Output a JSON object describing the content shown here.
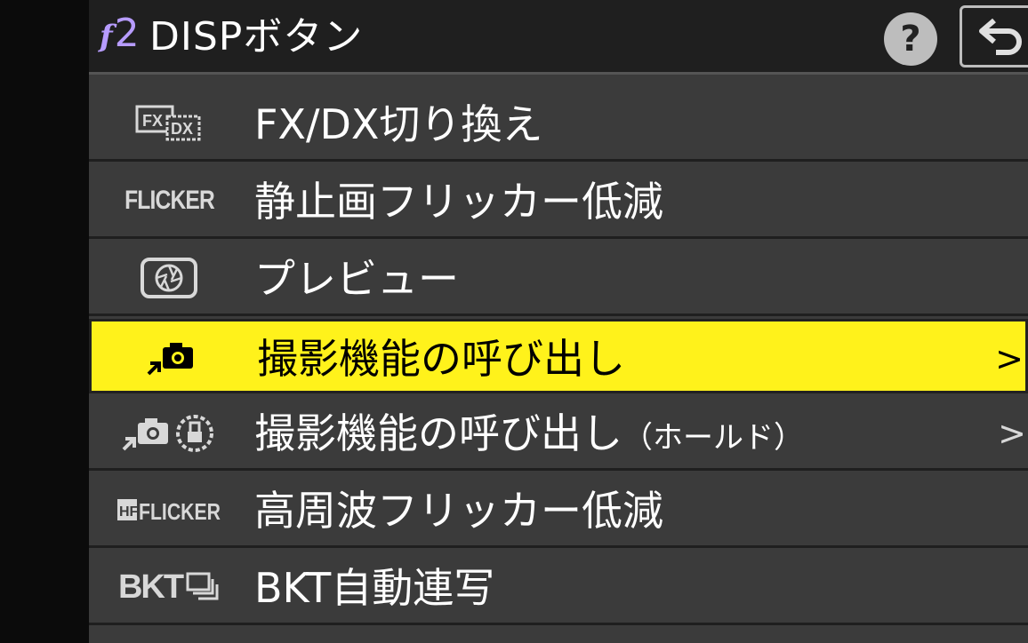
{
  "theme": {
    "accent": "#b79cff",
    "highlight": "#fff21b"
  },
  "header": {
    "tab_letter": "f",
    "tab_number": "2",
    "title": "DISPボタン",
    "help_symbol": "?",
    "back_icon": "return-arrow-icon"
  },
  "menu": {
    "items": [
      {
        "icon": "fx-dx-icon",
        "icon_text_1": "FX",
        "icon_text_2": "DX",
        "label": "FX/DX切り換え"
      },
      {
        "icon": "flicker-icon",
        "icon_text": "FLICKER",
        "label": "静止画フリッカー低減"
      },
      {
        "icon": "aperture-preview-icon",
        "label": "プレビュー"
      },
      {
        "icon": "camera-recall-icon",
        "label": "撮影機能の呼び出し",
        "selected": true,
        "has_submenu": true
      },
      {
        "icon": "camera-recall-hold-icon",
        "label": "撮影機能の呼び出し",
        "label_suffix": "（ホールド）",
        "has_submenu": true
      },
      {
        "icon": "hf-flicker-icon",
        "icon_text_1": "HF",
        "icon_text_2": "FLICKER",
        "label": "高周波フリッカー低減"
      },
      {
        "icon": "bkt-icon",
        "icon_text": "BKT",
        "label": "BKT自動連写"
      }
    ],
    "chevron": ">"
  }
}
